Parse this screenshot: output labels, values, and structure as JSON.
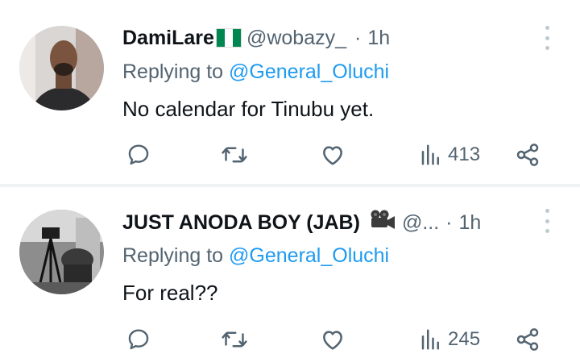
{
  "tweets": [
    {
      "display_name": "DamiLare",
      "flag": "nigeria-flag",
      "handle": "@wobazy_",
      "separator": "·",
      "time": "1h",
      "replying_prefix": "Replying to",
      "replying_to": "@General_Oluchi",
      "text": "No calendar for Tinubu yet.",
      "views": "413"
    },
    {
      "display_name": "JUST ANODA BOY (JAB)",
      "emoji": "video-camera",
      "handle": "@...",
      "separator": "·",
      "time": "1h",
      "replying_prefix": "Replying to",
      "replying_to": "@General_Oluchi",
      "text": "For real??",
      "views": "245"
    }
  ],
  "colors": {
    "text": "#0f1419",
    "secondary": "#536471",
    "link": "#1d9bf0",
    "divider": "#eff3f4",
    "flag_green": "#008751"
  }
}
